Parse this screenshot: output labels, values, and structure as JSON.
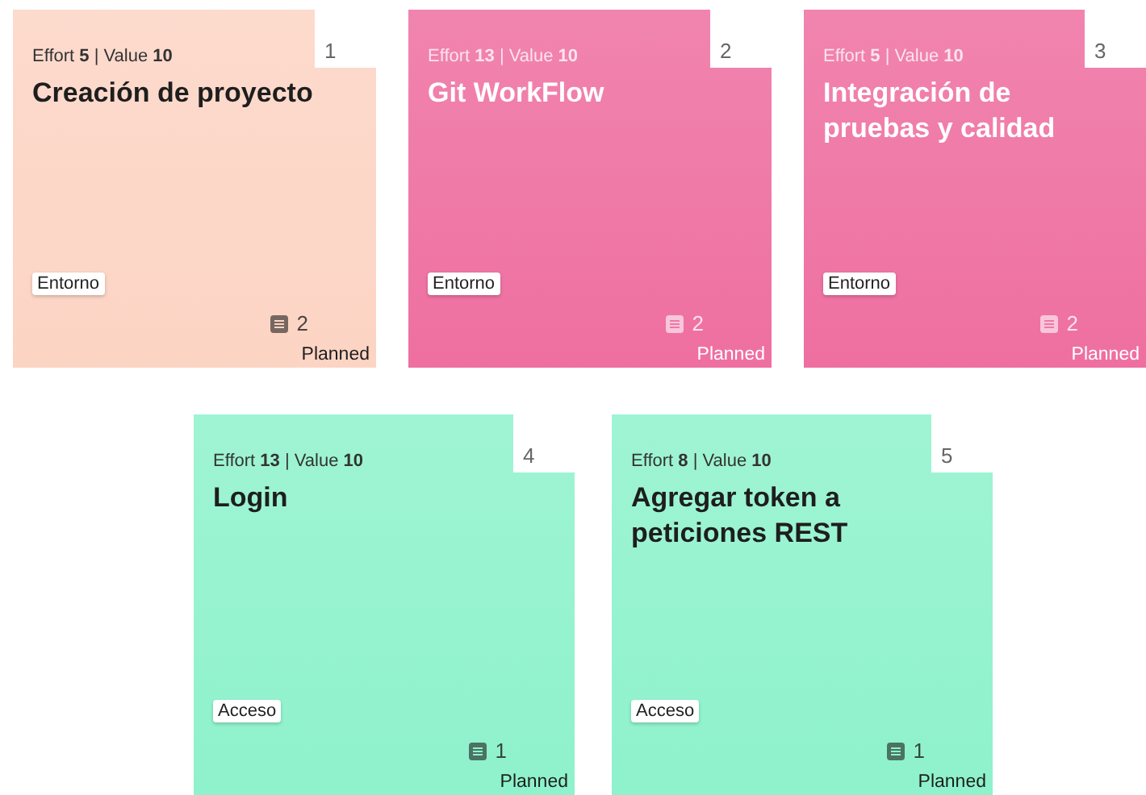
{
  "rows": [
    {
      "cards": [
        {
          "number": "1",
          "meta": "Effort **5** | Value **10**",
          "title": "Creación de proyecto",
          "tag": "Entorno",
          "tasks": "2",
          "status": "Planned",
          "color": "#fcd4c4",
          "kind": "dark"
        },
        {
          "number": "2",
          "meta": "Effort **13** | Value **10**",
          "title": "Git WorkFlow",
          "tag": "Entorno",
          "tasks": "2",
          "status": "Planned",
          "color": "#ee6fa0",
          "kind": "light"
        },
        {
          "number": "3",
          "meta": "Effort **5** | Value **10**",
          "title": "Integración de pruebas y calidad",
          "tag": "Entorno",
          "tasks": "2",
          "status": "Planned",
          "color": "#ee6fa0",
          "kind": "light"
        }
      ]
    },
    {
      "cards": [
        {
          "number": "4",
          "meta": "Effort **13** | Value **10**",
          "title": "Login",
          "tag": "Acceso",
          "tasks": "1",
          "status": "Planned",
          "color": "#8ef2cc",
          "kind": "dark"
        },
        {
          "number": "5",
          "meta": "Effort **8** | Value **10**",
          "title": "Agregar token a peticiones REST",
          "tag": "Acceso",
          "tasks": "1",
          "status": "Planned",
          "color": "#8ef2cc",
          "kind": "dark"
        }
      ]
    }
  ]
}
